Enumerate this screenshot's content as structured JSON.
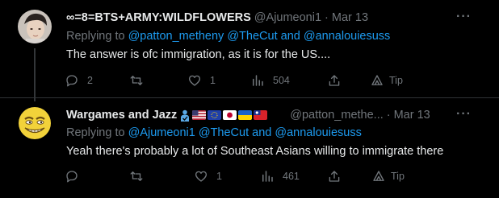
{
  "tweets": [
    {
      "display_name": "∞=8=BTS+ARMY:WILDFLOWERS",
      "handle": "@Ajumeoni1",
      "dot": "·",
      "date": "Mar 13",
      "replying_prefix": "Replying to",
      "replying_handle_1": "@patton_metheny",
      "replying_handle_2": "@TheCut",
      "replying_and": "and",
      "replying_handle_3": "@annalouiesuss",
      "text": "The answer is ofc immigration, as it is for the US....",
      "reply_count": "2",
      "retweet_count": "",
      "like_count": "1",
      "view_count": "504",
      "tip_label": "Tip"
    },
    {
      "display_name": "Wargames and Jazz",
      "handle": "@patton_methe...",
      "dot": "·",
      "date": "Mar 13",
      "replying_prefix": "Replying to",
      "replying_handle_1": "@Ajumeoni1",
      "replying_handle_2": "@TheCut",
      "replying_and": "and",
      "replying_handle_3": "@annalouiesuss",
      "text": "Yeah there's probably a lot of Southeast Asians willing to immigrate there",
      "reply_count": "",
      "retweet_count": "",
      "like_count": "1",
      "view_count": "461",
      "tip_label": "Tip"
    }
  ],
  "more_label": "···",
  "colors": {
    "background": "#000000",
    "text_primary": "#e7e9ea",
    "text_secondary": "#71767b",
    "link": "#1d9bf0",
    "divider": "#2f3336"
  },
  "icons": [
    "reply-icon",
    "retweet-icon",
    "like-icon",
    "views-icon",
    "share-icon",
    "tip-icon",
    "more-icon",
    "verified-emoji-icon",
    "flag-usa-icon",
    "flag-eu-icon",
    "flag-japan-icon",
    "flag-ukraine-icon",
    "flag-taiwan-icon"
  ]
}
